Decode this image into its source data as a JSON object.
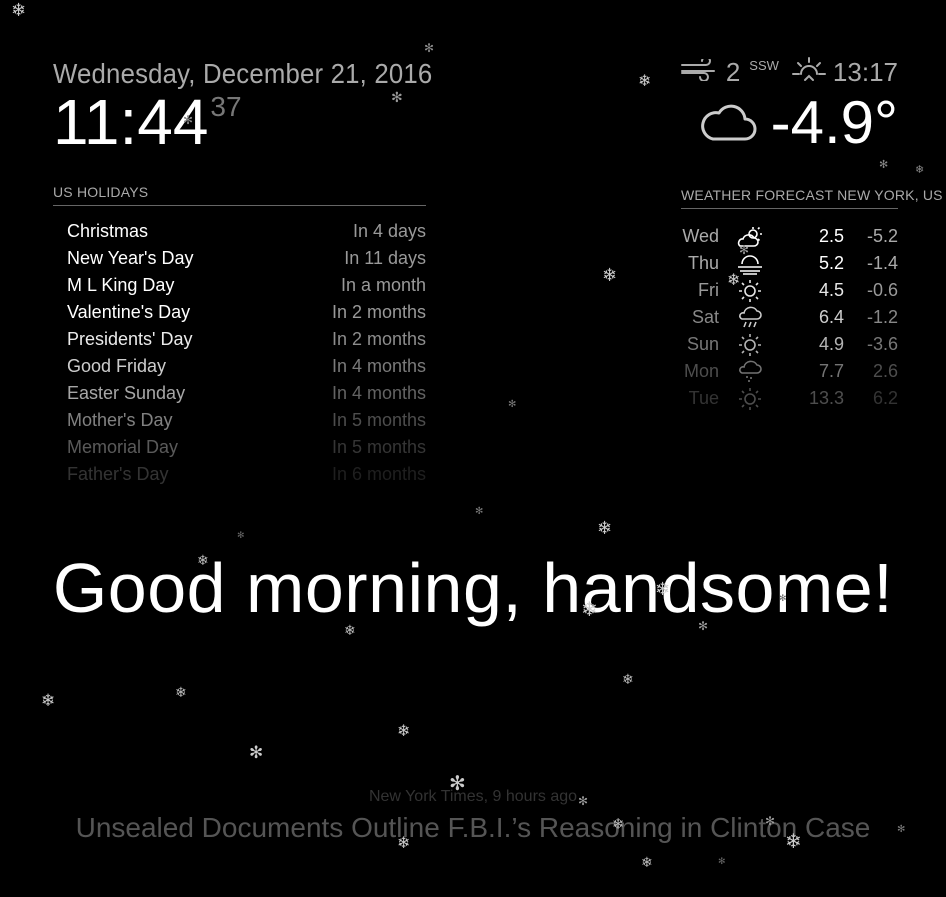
{
  "clock": {
    "date": "Wednesday, December 21, 2016",
    "hours_minutes": "11:44",
    "seconds": "37"
  },
  "holidays": {
    "header": "US HOLIDAYS",
    "items": [
      {
        "name": "Christmas",
        "when": "In 4 days"
      },
      {
        "name": "New Year's Day",
        "when": "In 11 days"
      },
      {
        "name": "M L King Day",
        "when": "In a month"
      },
      {
        "name": "Valentine's Day",
        "when": "In 2 months"
      },
      {
        "name": "Presidents' Day",
        "when": "In 2 months"
      },
      {
        "name": "Good Friday",
        "when": "In 4 months"
      },
      {
        "name": "Easter Sunday",
        "when": "In 4 months"
      },
      {
        "name": "Mother's Day",
        "when": "In 5 months"
      },
      {
        "name": "Memorial Day",
        "when": "In 5 months"
      },
      {
        "name": "Father's Day",
        "when": "In 6 months"
      }
    ]
  },
  "current_weather": {
    "wind_speed": "2",
    "wind_direction": "SSW",
    "sunset_time": "13:17",
    "temperature": "-4.9°",
    "condition_icon": "cloudy-icon",
    "wind_icon": "wind-icon",
    "sun_icon": "sunrise-icon"
  },
  "forecast": {
    "header": "WEATHER FORECAST NEW YORK, US",
    "days": [
      {
        "day": "Wed",
        "icon": "partly-cloudy-icon",
        "max": "2.5",
        "min": "-5.2"
      },
      {
        "day": "Thu",
        "icon": "fog-icon",
        "max": "5.2",
        "min": "-1.4"
      },
      {
        "day": "Fri",
        "icon": "sun-icon",
        "max": "4.5",
        "min": "-0.6"
      },
      {
        "day": "Sat",
        "icon": "rain-icon",
        "max": "6.4",
        "min": "-1.2"
      },
      {
        "day": "Sun",
        "icon": "sun-icon",
        "max": "4.9",
        "min": "-3.6"
      },
      {
        "day": "Mon",
        "icon": "showers-icon",
        "max": "7.7",
        "min": "2.6"
      },
      {
        "day": "Tue",
        "icon": "sun-icon",
        "max": "13.3",
        "min": "6.2"
      }
    ]
  },
  "compliment": {
    "text": "Good morning, handsome!"
  },
  "news": {
    "source": "New York Times, 9 hours ago",
    "headline": "Unsealed Documents Outline F.B.I.’s Reasoning in Clinton Case"
  },
  "decor": {
    "snowflake_icon": "snowflake-icon"
  }
}
